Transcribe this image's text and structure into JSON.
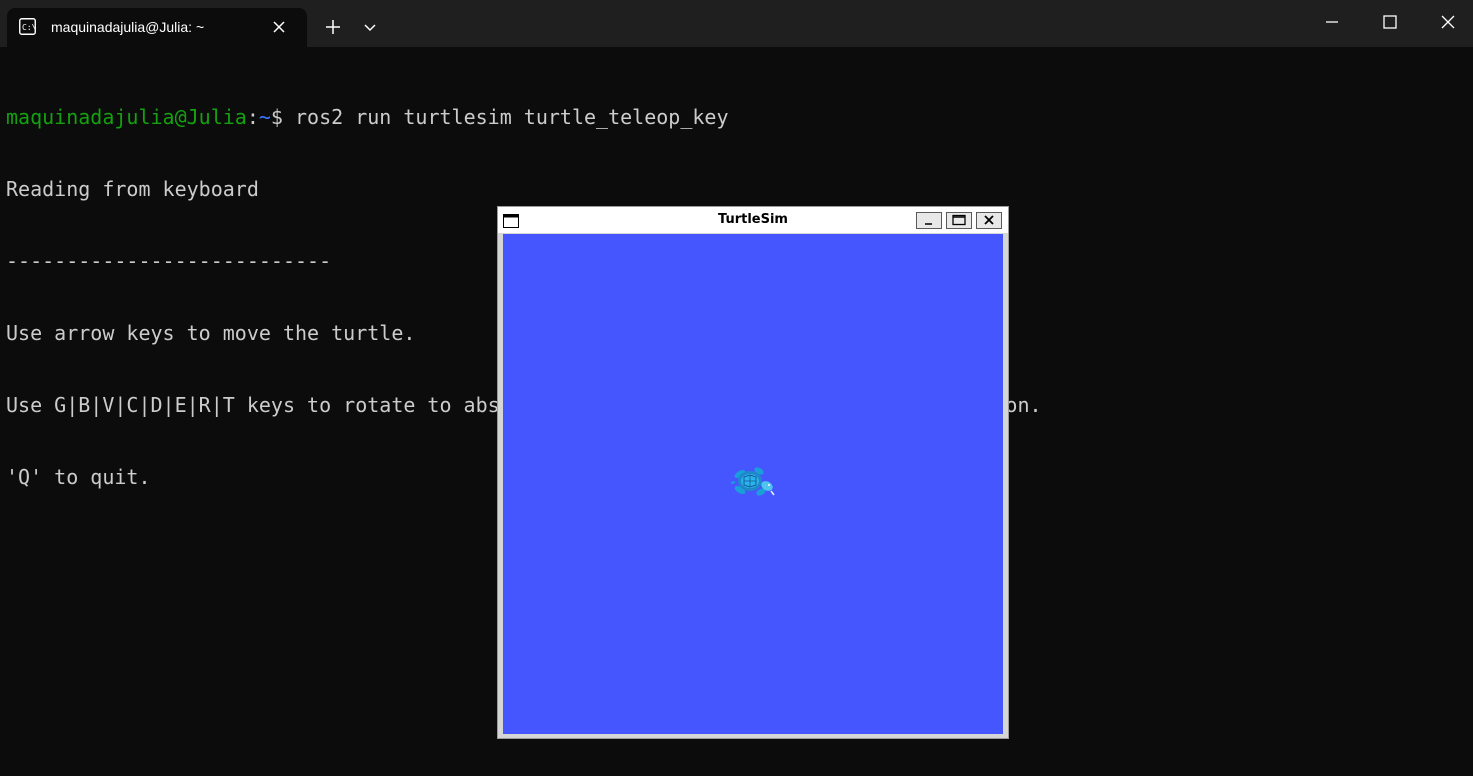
{
  "window": {
    "tab_title": "maquinadajulia@Julia: ~",
    "icons": {
      "tab": "terminal-icon",
      "tab_close": "close-icon",
      "new_tab": "plus-icon",
      "dropdown": "chevron-down-icon",
      "minimize": "minimize-icon",
      "maximize": "maximize-icon",
      "close": "close-icon"
    }
  },
  "terminal": {
    "prompt_user": "maquinadajulia@Julia",
    "prompt_colon": ":",
    "prompt_path": "~",
    "prompt_symbol": "$ ",
    "command": "ros2 run turtlesim turtle_teleop_key",
    "output": [
      "Reading from keyboard",
      "---------------------------",
      "Use arrow keys to move the turtle.",
      "Use G|B|V|C|D|E|R|T keys to rotate to absolute orientations. 'F' to cancel a rotation.",
      "'Q' to quit."
    ]
  },
  "turtlesim": {
    "title": "TurtleSim",
    "background_color": "#4556ff",
    "icons": {
      "menu": "window-menu-icon",
      "minimize": "minimize-icon",
      "maximize": "maximize-icon",
      "close": "close-icon",
      "turtle": "turtle-icon"
    }
  },
  "colors": {
    "terminal_bg": "#0c0c0c",
    "titlebar_bg": "#1f1f1f",
    "prompt_user": "#13a10e",
    "prompt_path": "#3b78ff",
    "text": "#cccccc"
  }
}
